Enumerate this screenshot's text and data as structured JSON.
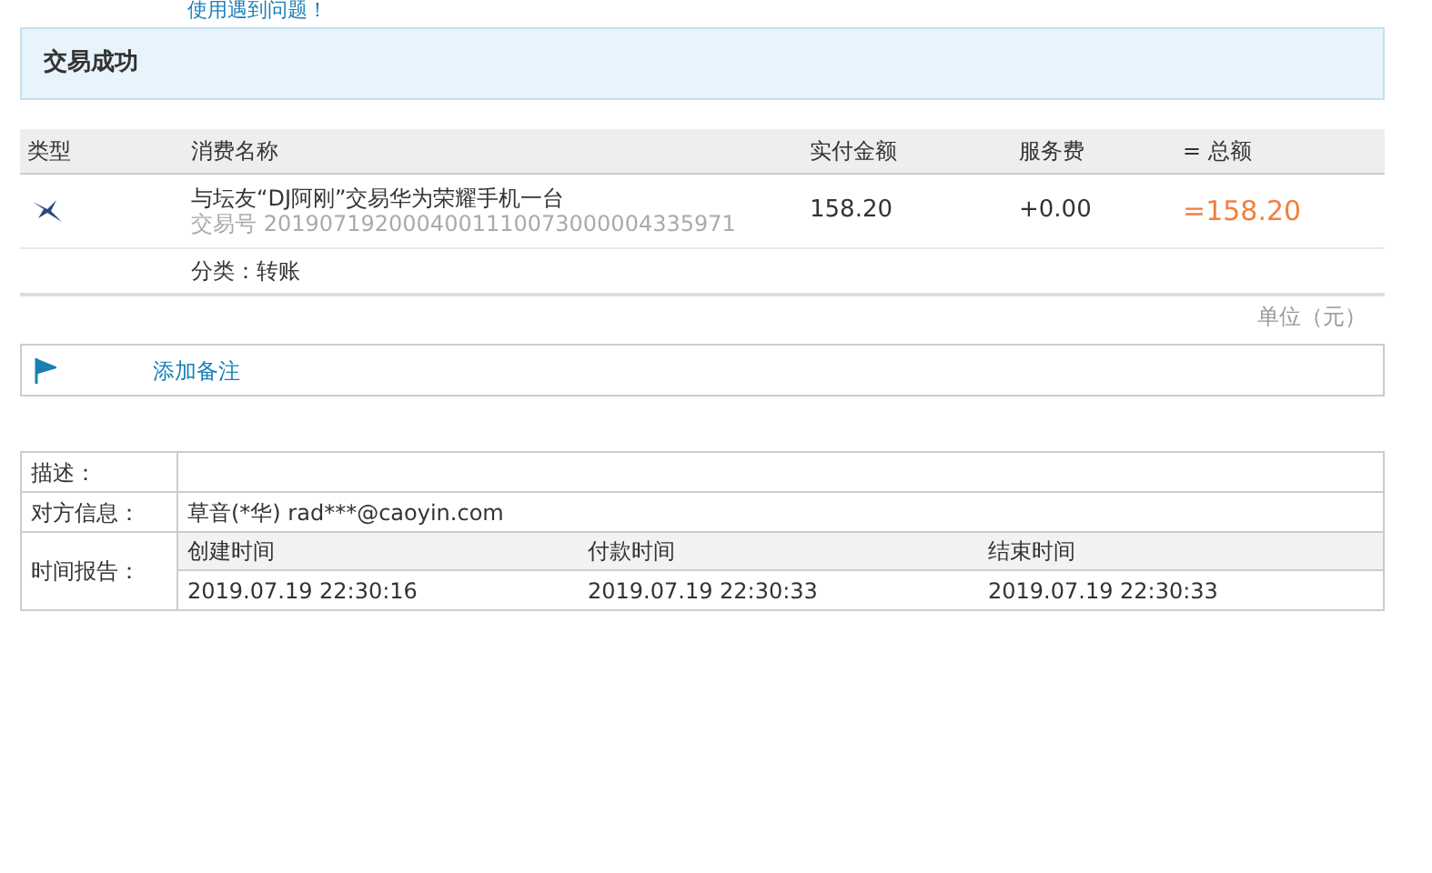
{
  "help_link": "使用遇到问题！",
  "status_banner": {
    "title": "交易成功"
  },
  "table": {
    "columns": [
      "类型",
      "消费名称",
      "实付金额",
      "服务费",
      "= 总额"
    ],
    "rows": [
      {
        "name": "与坛友“DJ阿刚”交易华为荣耀手机一台",
        "trade_no": "交易号 2019071920004001110073000004335971",
        "amount": "158.20",
        "fee": "+0.00",
        "total": "=158.20"
      }
    ],
    "category": "分类：转账",
    "unit": "单位（元）"
  },
  "remark": {
    "label": "添加备注"
  },
  "info": {
    "description_label": "描述：",
    "counterparty_label": "对方信息：",
    "counterparty": "草音(*华) rad***@caoyin.com",
    "time_label": "时间报告：",
    "times": [
      {
        "label": "创建时间",
        "value": "2019.07.19 22:30:16"
      },
      {
        "label": "付款时间",
        "value": "2019.07.19 22:30:33"
      },
      {
        "label": "结束时间",
        "value": "2019.07.19 22:30:33"
      }
    ]
  }
}
